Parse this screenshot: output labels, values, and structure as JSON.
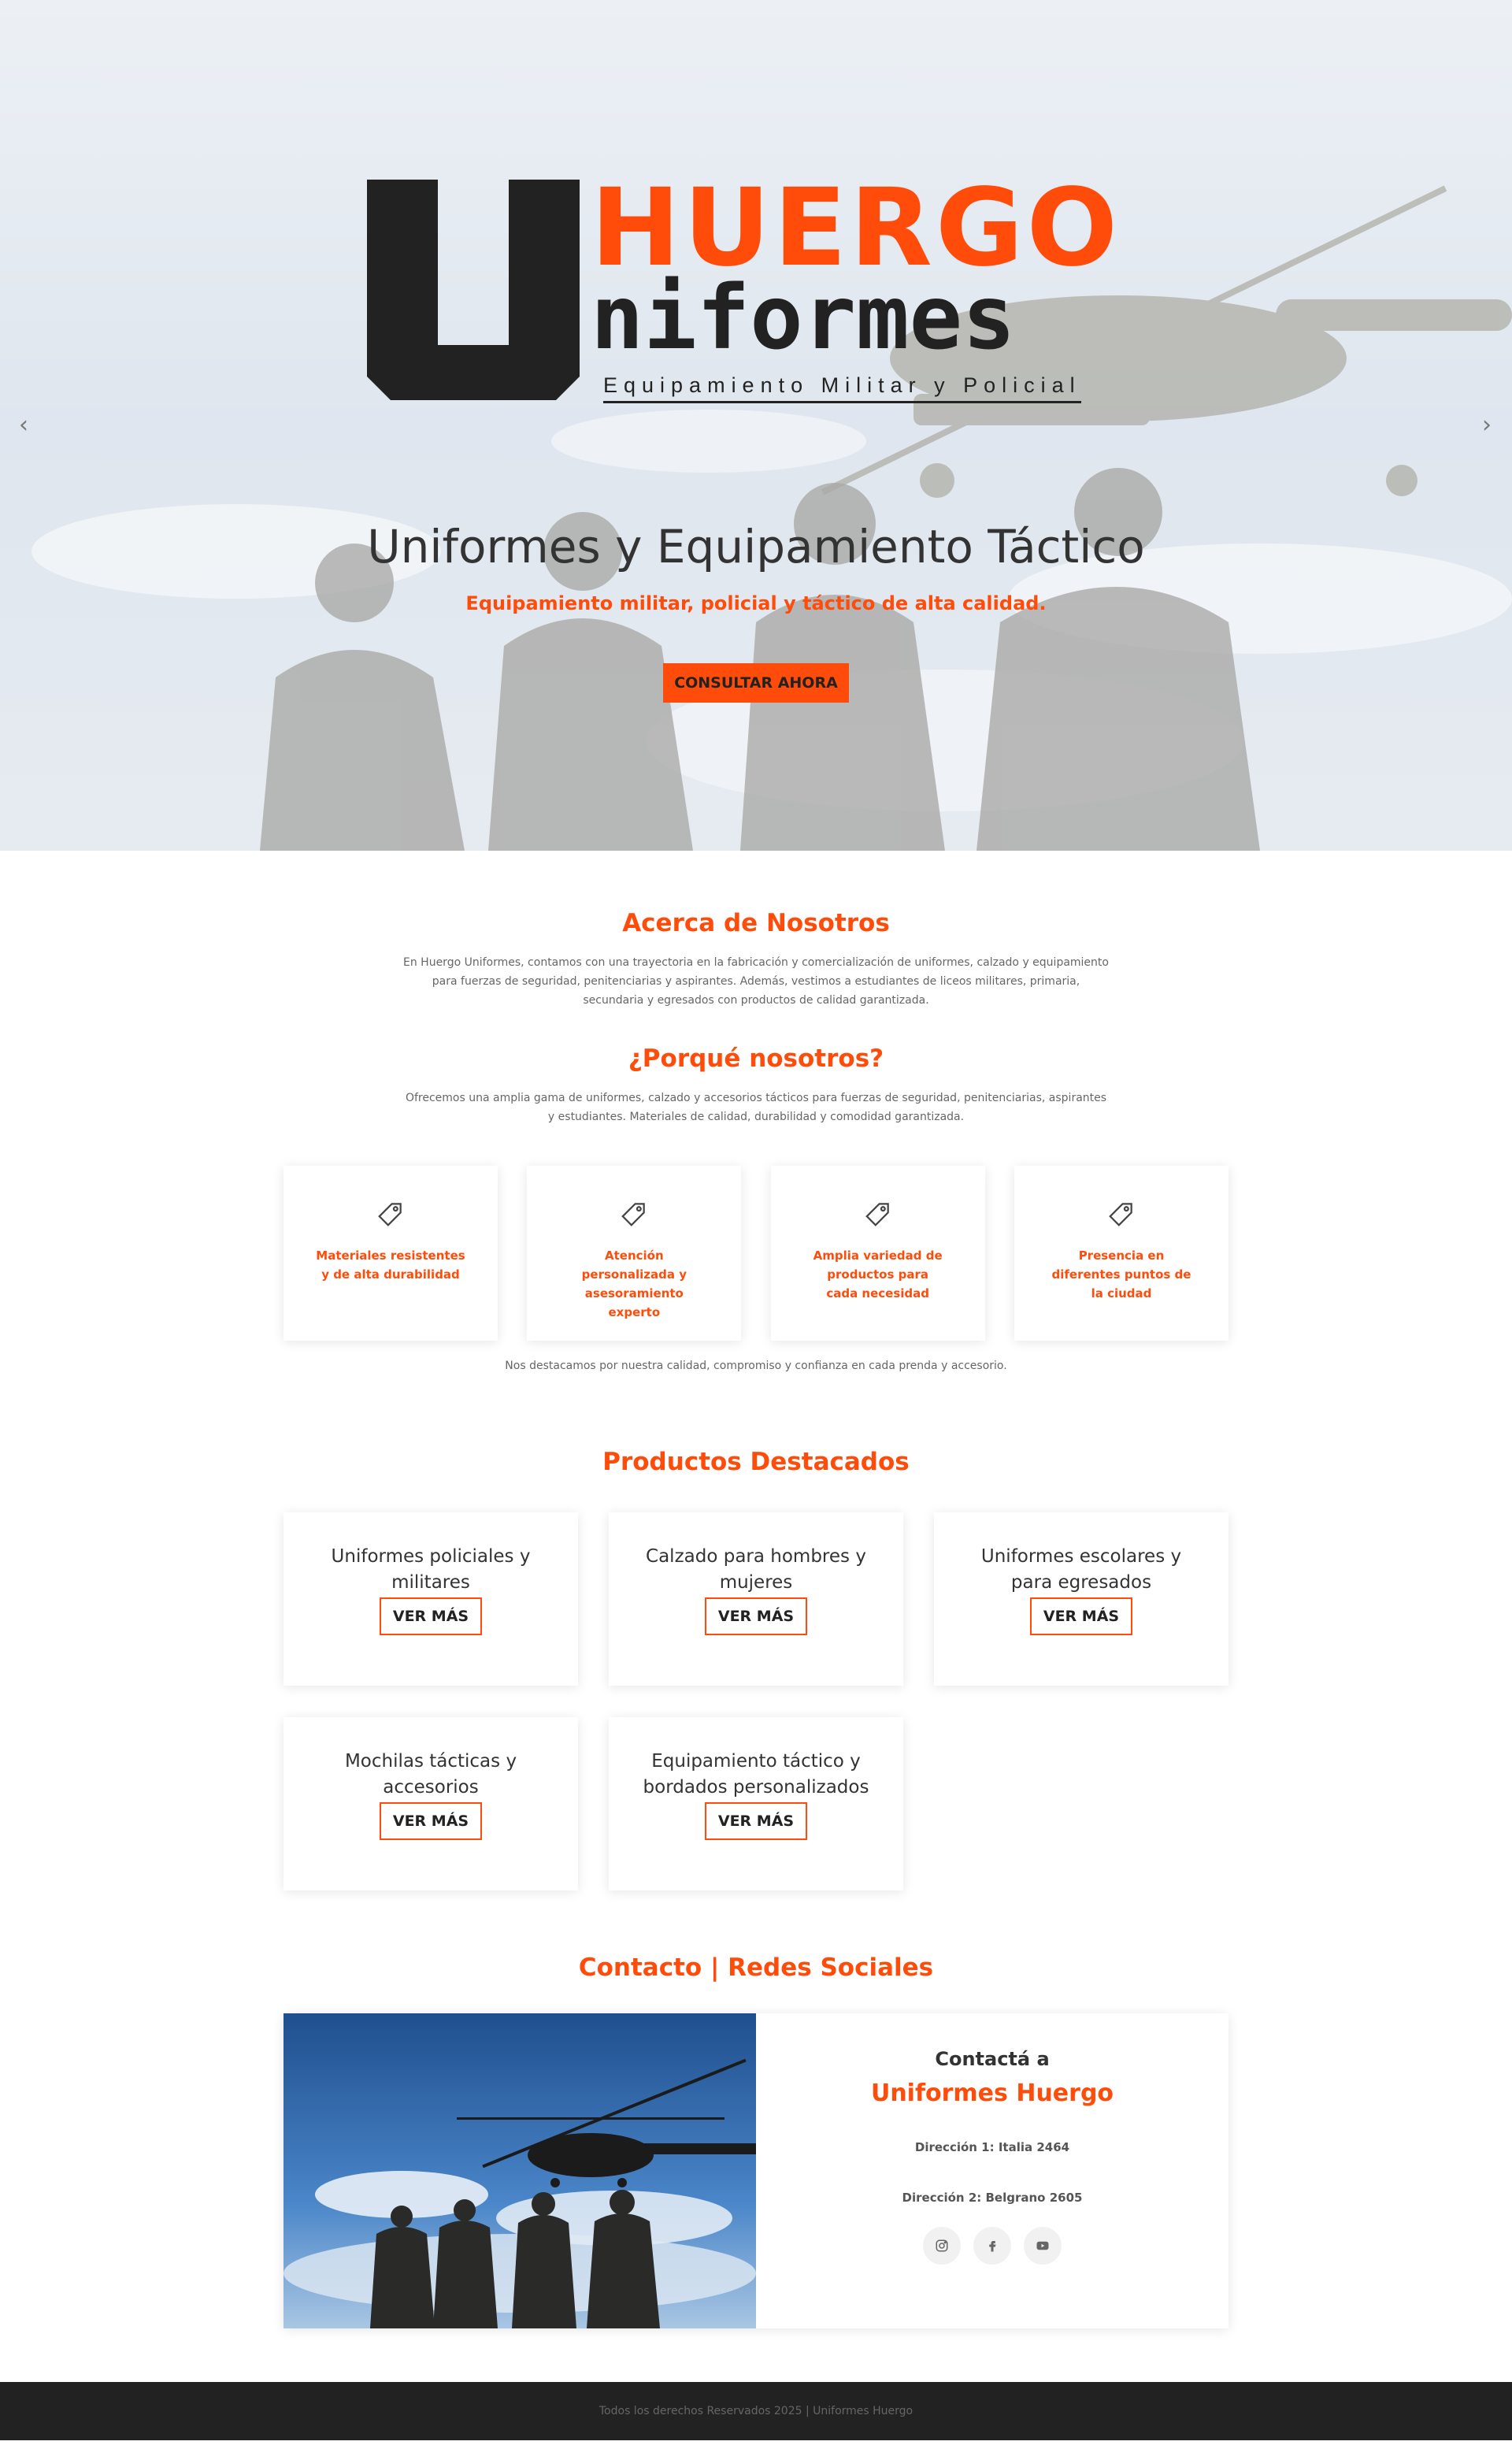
{
  "hero": {
    "logo": {
      "letter": "U",
      "line1": "HUERGO",
      "line2": "niformes",
      "tagline": "Equipamiento Militar y Policial"
    },
    "title": "Uniformes y Equipamiento Táctico",
    "subtitle": "Equipamiento militar, policial y táctico de alta calidad.",
    "cta_label": "CONSULTAR AHORA",
    "prev_icon": "chevron-left-icon",
    "next_icon": "chevron-right-icon",
    "prev_glyph": "‹",
    "next_glyph": "›"
  },
  "about": {
    "title": "Acerca de Nosotros",
    "text": "En Huergo Uniformes, contamos con una trayectoria en la fabricación y comercialización de uniformes, calzado y equipamiento para fuerzas de seguridad, penitenciarias y aspirantes. Además, vestimos a estudiantes de liceos militares, primaria, secundaria y egresados con productos de calidad garantizada."
  },
  "why": {
    "title": "¿Porqué nosotros?",
    "text": "Ofrecemos una amplia gama de uniformes, calzado y accesorios tácticos para fuerzas de seguridad, penitenciarias, aspirantes y estudiantes. Materiales de calidad, durabilidad y comodidad garantizada.",
    "features": [
      {
        "icon": "tag-icon",
        "label": "Materiales resistentes y de alta durabilidad"
      },
      {
        "icon": "tag-icon",
        "label": "Atención personalizada y asesoramiento experto"
      },
      {
        "icon": "tag-icon",
        "label": "Amplia variedad de productos para cada necesidad"
      },
      {
        "icon": "tag-icon",
        "label": "Presencia en diferentes puntos de la ciudad"
      }
    ],
    "footer_text": "Nos destacamos por nuestra calidad, compromiso y confianza en cada prenda y accesorio."
  },
  "products": {
    "title": "Productos Destacados",
    "button_label": "VER MÁS",
    "items": [
      {
        "name": "Uniformes policiales y militares",
        "button": "VER MÁS"
      },
      {
        "name": "Calzado para hombres y mujeres",
        "button": "VER MÁS"
      },
      {
        "name": "Uniformes escolares y para egresados",
        "button": "VER MÁS"
      },
      {
        "name": "Mochilas tácticas y accesorios",
        "button": "VER MÁS"
      },
      {
        "name": "Equipamiento táctico y bordados personalizados",
        "button": "VER MÁS"
      }
    ]
  },
  "contact": {
    "title": "Contacto | Redes Sociales",
    "pre": "Contactá a",
    "name": "Uniformes Huergo",
    "address1": "Dirección 1: Italia 2464",
    "address2": "Dirección 2: Belgrano 2605",
    "socials": [
      "instagram-icon",
      "facebook-icon",
      "youtube-icon"
    ]
  },
  "footer": {
    "text": "Todos los derechos Reservados 2025 | Uniformes Huergo"
  },
  "colors": {
    "accent": "#ff4c0a",
    "dark": "#222222",
    "footer_bg": "#222222"
  }
}
